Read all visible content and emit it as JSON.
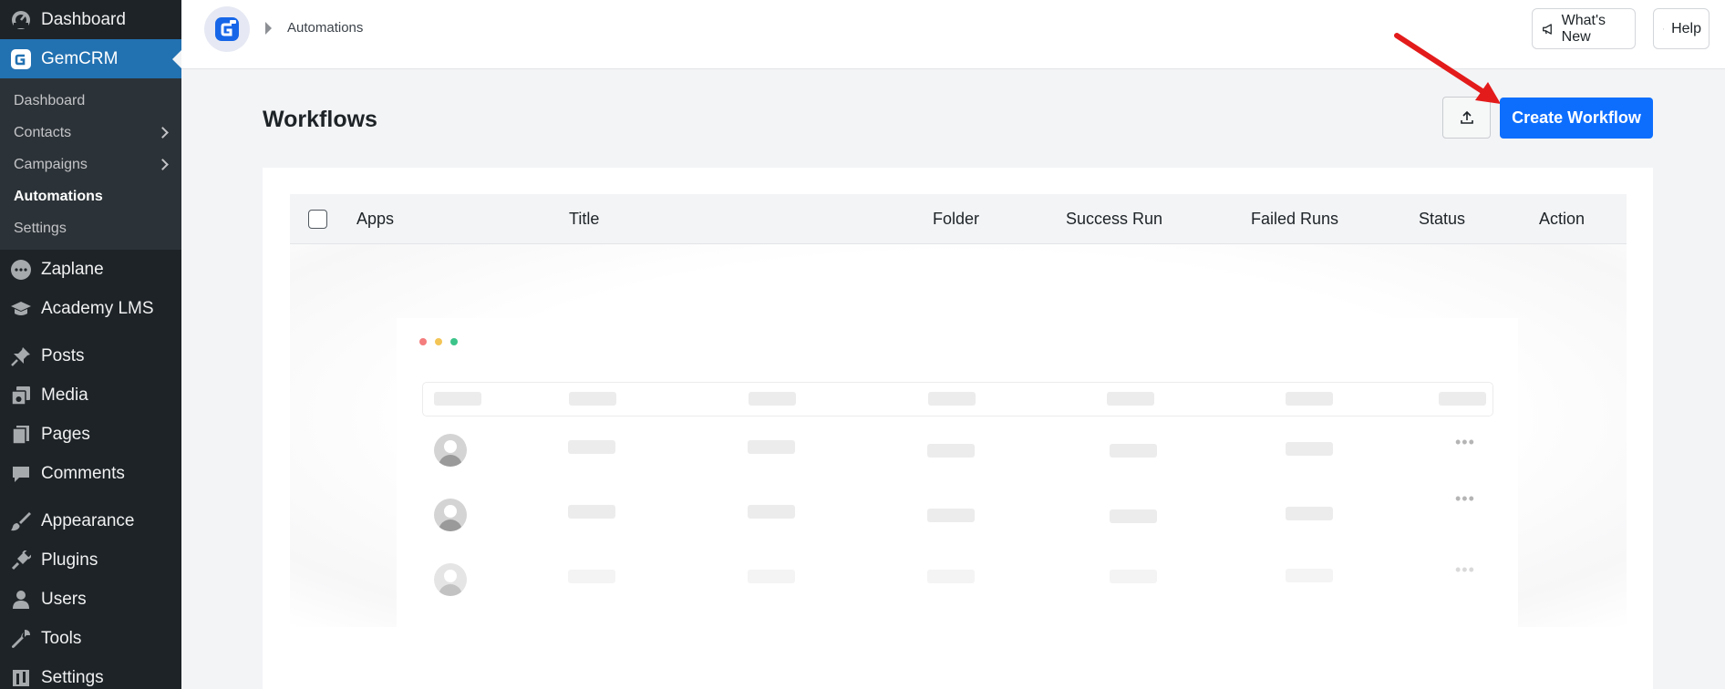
{
  "sidebar": {
    "top_items": [
      {
        "label": "Dashboard",
        "icon": "dashboard-gauge-icon"
      },
      {
        "label": "GemCRM",
        "icon": "gemcrm-logo-icon",
        "current": true
      }
    ],
    "submenu": [
      {
        "label": "Dashboard"
      },
      {
        "label": "Contacts",
        "has_children": true
      },
      {
        "label": "Campaigns",
        "has_children": true
      },
      {
        "label": "Automations",
        "active": true
      },
      {
        "label": "Settings"
      }
    ],
    "bottom_items": [
      {
        "label": "Zaplane",
        "icon": "zaplane-icon"
      },
      {
        "label": "Academy LMS",
        "icon": "graduation-cap-icon"
      },
      {
        "label": "Posts",
        "icon": "pushpin-icon"
      },
      {
        "label": "Media",
        "icon": "media-icon"
      },
      {
        "label": "Pages",
        "icon": "pages-icon"
      },
      {
        "label": "Comments",
        "icon": "comment-bubble-icon"
      },
      {
        "label": "Appearance",
        "icon": "paintbrush-icon"
      },
      {
        "label": "Plugins",
        "icon": "plug-icon"
      },
      {
        "label": "Users",
        "icon": "user-icon"
      },
      {
        "label": "Tools",
        "icon": "wrench-icon"
      },
      {
        "label": "Settings",
        "icon": "settings-icon"
      }
    ]
  },
  "header": {
    "breadcrumb": "Automations",
    "whats_new_label": "What's New",
    "help_label": "Help"
  },
  "main": {
    "title": "Workflows",
    "create_button_label": "Create Workflow",
    "export_icon": "upload-icon",
    "table": {
      "columns": [
        "Apps",
        "Title",
        "Folder",
        "Success Run",
        "Failed Runs",
        "Status",
        "Action"
      ]
    }
  },
  "colors": {
    "sidebar_bg": "#1d2327",
    "sidebar_current": "#2271b1",
    "primary_button": "#0d6efd",
    "annotation_arrow": "#e31b1b"
  }
}
